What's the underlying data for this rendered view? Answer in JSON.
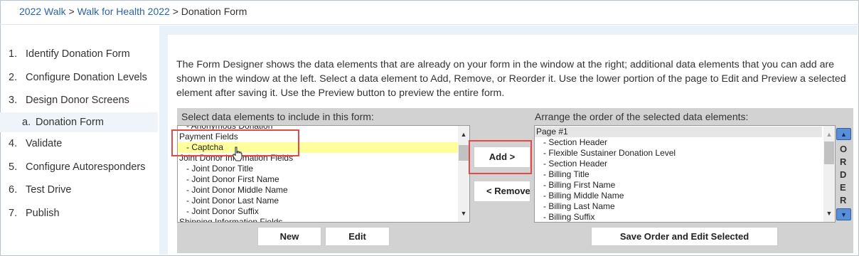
{
  "breadcrumb": {
    "link1": "2022 Walk",
    "sep1": " > ",
    "link2": "Walk for Health 2022",
    "sep2": " > ",
    "current": "Donation Form"
  },
  "sidebar": {
    "steps": [
      {
        "num": "1.",
        "label": "Identify Donation Form"
      },
      {
        "num": "2.",
        "label": "Configure Donation Levels"
      },
      {
        "num": "3.",
        "label": "Design Donor Screens"
      },
      {
        "num": "a.",
        "label": "Donation Form"
      },
      {
        "num": "4.",
        "label": "Validate"
      },
      {
        "num": "5.",
        "label": "Configure Autoresponders"
      },
      {
        "num": "6.",
        "label": "Test Drive"
      },
      {
        "num": "7.",
        "label": "Publish"
      }
    ]
  },
  "description": "The Form Designer shows the data elements that are already on your form in the window at the right; additional data elements that you can add are shown in the window at the left. Select a data element to Add, Remove, or Reorder it. Use the lower portion of the page to Edit and Preview a selected element after saving it. Use the Preview button to preview the entire form.",
  "designer": {
    "left_header": "Select data elements to include in this form:",
    "right_header": "Arrange the order of the selected data elements:",
    "left_items": [
      {
        "text": "- Anonymous Donation",
        "indent": true
      },
      {
        "text": "Payment Fields",
        "indent": false
      },
      {
        "text": "- Captcha",
        "indent": true,
        "selected": true
      },
      {
        "text": "Joint Donor Information Fields",
        "indent": false
      },
      {
        "text": "- Joint Donor Title",
        "indent": true
      },
      {
        "text": "- Joint Donor First Name",
        "indent": true
      },
      {
        "text": "- Joint Donor Middle Name",
        "indent": true
      },
      {
        "text": "- Joint Donor Last Name",
        "indent": true
      },
      {
        "text": "- Joint Donor Suffix",
        "indent": true
      },
      {
        "text": "Shipping Information Fields",
        "indent": false
      }
    ],
    "right_items": [
      {
        "text": "Page #1",
        "indent": false,
        "page": true
      },
      {
        "text": "- Section Header",
        "indent": true
      },
      {
        "text": "- Flexible Sustainer Donation Level",
        "indent": true
      },
      {
        "text": "- Section Header",
        "indent": true
      },
      {
        "text": "- Billing Title",
        "indent": true
      },
      {
        "text": "- Billing First Name",
        "indent": true
      },
      {
        "text": "- Billing Middle Name",
        "indent": true
      },
      {
        "text": "- Billing Last Name",
        "indent": true
      },
      {
        "text": "- Billing Suffix",
        "indent": true
      }
    ],
    "add_label": "Add >",
    "remove_label": "< Remove",
    "new_label": "New",
    "edit_label": "Edit",
    "save_order_label": "Save Order and Edit Selected",
    "order_letters": [
      "O",
      "R",
      "D",
      "E",
      "R"
    ]
  },
  "colors": {
    "link": "#2a64a8",
    "selected_row": "#ffff9e",
    "highlight_box": "#e24a4a",
    "designer_bg": "#d2d2d2",
    "order_button": "#5a8fd6"
  }
}
